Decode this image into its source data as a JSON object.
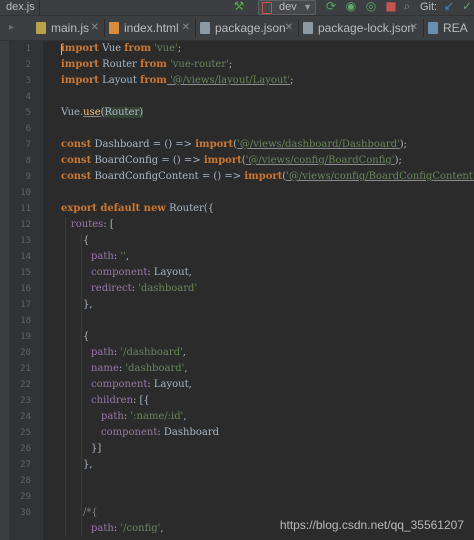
{
  "toolbar": {
    "breadcrumb": "dex.js",
    "run_config": "dev",
    "git_label": "Git:"
  },
  "tabs": [
    {
      "label": "main.js",
      "icon": "js-file-icon",
      "active": false
    },
    {
      "label": "index.html",
      "icon": "html-file-icon",
      "active": false
    },
    {
      "label": "package.json",
      "icon": "json-file-icon",
      "active": false
    },
    {
      "label": "package-lock.json",
      "icon": "json-file-icon",
      "active": false
    },
    {
      "label": "REA",
      "icon": "markdown-file-icon",
      "active": false
    }
  ],
  "line_numbers": [
    "1",
    "2",
    "3",
    "4",
    "5",
    "6",
    "7",
    "8",
    "9",
    "10",
    "11",
    "12",
    "13",
    "14",
    "15",
    "16",
    "17",
    "18",
    "19",
    "20",
    "21",
    "22",
    "23",
    "24",
    "25",
    "26",
    "27",
    "28",
    "29",
    "30"
  ],
  "code": {
    "l1": {
      "kw1": "import",
      "t1": " Vue ",
      "kw2": "from",
      "s1": " 'vue'",
      "t2": ";"
    },
    "l2": {
      "kw1": "import",
      "t1": " Router ",
      "kw2": "from",
      "s1": " 'vue-router'",
      "t2": ";"
    },
    "l3": {
      "kw1": "import",
      "t1": " Layout ",
      "kw2": "from",
      "s1": " '@/views/layout/Layout'",
      "t2": ";"
    },
    "l5": {
      "t1": "Vue.",
      "fn": "use",
      "t2": "(Router)"
    },
    "l7": {
      "kw1": "const",
      "t1": " Dashboard = () => ",
      "kw2": "import",
      "t2": "(",
      "s1": "'@/views/dashboard/Dashboard'",
      "t3": ");"
    },
    "l8": {
      "kw1": "const",
      "t1": " BoardConfig = () => ",
      "kw2": "import",
      "t2": "(",
      "s1": "'@/views/config/BoardConfig'",
      "t3": ");"
    },
    "l9": {
      "kw1": "const",
      "t1": " BoardConfigContent = () => ",
      "kw2": "import",
      "t2": "(",
      "s1": "'@/views/config/BoardConfigContent'",
      "t3": ");"
    },
    "l11": {
      "kw1": "export",
      "kw2": " default",
      "kw3": " new",
      "t1": " Router({"
    },
    "l12": {
      "p": "routes",
      "t1": ": ["
    },
    "l13": {
      "t1": "{"
    },
    "l14": {
      "p": "path",
      "t1": ": ",
      "s1": "''",
      "t2": ","
    },
    "l15": {
      "p": "component",
      "t1": ": Layout,"
    },
    "l16": {
      "p": "redirect",
      "t1": ": ",
      "s1": "'dashboard'"
    },
    "l17": {
      "t1": "},"
    },
    "l19": {
      "t1": "{"
    },
    "l20": {
      "p": "path",
      "t1": ": ",
      "s1": "'/dashboard'",
      "t2": ","
    },
    "l21": {
      "p": "name",
      "t1": ": ",
      "s1": "'dashboard'",
      "t2": ","
    },
    "l22": {
      "p": "component",
      "t1": ": Layout,"
    },
    "l23": {
      "p": "children",
      "t1": ": [{"
    },
    "l24": {
      "p": "path",
      "t1": ": ",
      "s1": "':name/:id'",
      "t2": ","
    },
    "l25": {
      "p": "component",
      "t1": ": Dashboard"
    },
    "l26": {
      "t1": "}]"
    },
    "l27": {
      "t1": "},"
    },
    "l30": {
      "c1": "/*{"
    },
    "l31": {
      "p": "path",
      "t1": ": ",
      "s1": "'/config'",
      "t2": ","
    }
  },
  "watermark": "https://blog.csdn.net/qq_35561207",
  "colors": {
    "background": "#2b2b2b",
    "keyword": "#cc7832",
    "string": "#6a8759",
    "property": "#9876aa",
    "function": "#ffc66d",
    "default_text": "#a9b7c6"
  }
}
